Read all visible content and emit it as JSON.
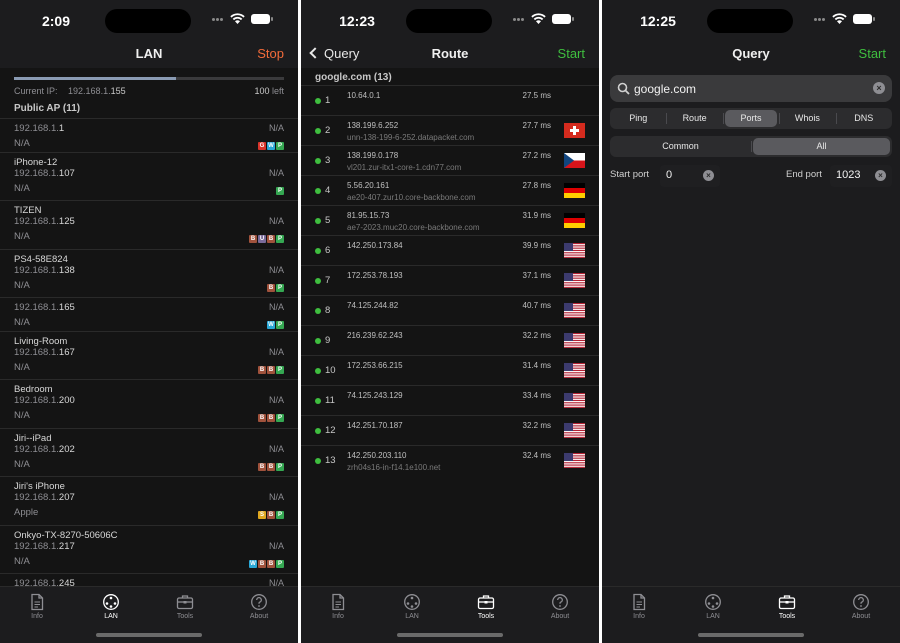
{
  "screens": {
    "lan": {
      "time": "2:09",
      "title": "LAN",
      "action": "Stop",
      "scan_progress": 0.6,
      "current_ip_label": "Current IP:",
      "current_ip_prefix": "192.168.1.",
      "current_ip_suffix": "155",
      "left_count": "100",
      "left_label": "left",
      "section": "Public AP (11)",
      "devices": [
        {
          "name": "",
          "ip_prefix": "192.168.1.",
          "ip_suffix": "1",
          "vendor": "N/A",
          "na": "N/A",
          "badges": [
            "G",
            "W",
            "P"
          ]
        },
        {
          "name": "iPhone-12",
          "ip_prefix": "192.168.1.",
          "ip_suffix": "107",
          "vendor": "N/A",
          "na": "N/A",
          "badges": [
            "P"
          ]
        },
        {
          "name": "TIZEN",
          "ip_prefix": "192.168.1.",
          "ip_suffix": "125",
          "vendor": "N/A",
          "na": "N/A",
          "badges": [
            "B",
            "U",
            "B",
            "P"
          ]
        },
        {
          "name": "PS4-58E824",
          "ip_prefix": "192.168.1.",
          "ip_suffix": "138",
          "vendor": "N/A",
          "na": "N/A",
          "badges": [
            "B",
            "P"
          ]
        },
        {
          "name": "",
          "ip_prefix": "192.168.1.",
          "ip_suffix": "165",
          "vendor": "N/A",
          "na": "N/A",
          "badges": [
            "W",
            "P"
          ]
        },
        {
          "name": "Living-Room",
          "ip_prefix": "192.168.1.",
          "ip_suffix": "167",
          "vendor": "N/A",
          "na": "N/A",
          "badges": [
            "B",
            "B",
            "P"
          ]
        },
        {
          "name": "Bedroom",
          "ip_prefix": "192.168.1.",
          "ip_suffix": "200",
          "vendor": "N/A",
          "na": "N/A",
          "badges": [
            "B",
            "B",
            "P"
          ]
        },
        {
          "name": "Jiri--iPad",
          "ip_prefix": "192.168.1.",
          "ip_suffix": "202",
          "vendor": "N/A",
          "na": "N/A",
          "badges": [
            "B",
            "B",
            "P"
          ]
        },
        {
          "name": "Jiri's iPhone",
          "ip_prefix": "192.168.1.",
          "ip_suffix": "207",
          "vendor": "Apple",
          "na": "N/A",
          "badges": [
            "S",
            "B",
            "P"
          ]
        },
        {
          "name": "Onkyo-TX-8270-50606C",
          "ip_prefix": "192.168.1.",
          "ip_suffix": "217",
          "vendor": "N/A",
          "na": "N/A",
          "badges": [
            "W",
            "B",
            "B",
            "P"
          ]
        },
        {
          "name": "",
          "ip_prefix": "192.168.1.",
          "ip_suffix": "245",
          "vendor": "",
          "na": "N/A",
          "badges": []
        }
      ],
      "badge_colors": {
        "G": "#d9342b",
        "W": "#2aa7d6",
        "P": "#35a852",
        "B": "#a0523c",
        "U": "#7a6b9a",
        "S": "#e0a820"
      }
    },
    "route": {
      "time": "12:23",
      "back": "Query",
      "title": "Route",
      "action": "Start",
      "header": "google.com (13)",
      "hops": [
        {
          "n": "1",
          "addr": "10.64.0.1",
          "host": "",
          "ms": "27.5 ms",
          "flag": ""
        },
        {
          "n": "2",
          "addr": "138.199.6.252",
          "host": "unn-138-199-6-252.datapacket.com",
          "ms": "27.7 ms",
          "flag": "ch"
        },
        {
          "n": "3",
          "addr": "138.199.0.178",
          "host": "vl201.zur-itx1-core-1.cdn77.com",
          "ms": "27.2 ms",
          "flag": "cz"
        },
        {
          "n": "4",
          "addr": "5.56.20.161",
          "host": "ae20-407.zur10.core-backbone.com",
          "ms": "27.8 ms",
          "flag": "de"
        },
        {
          "n": "5",
          "addr": "81.95.15.73",
          "host": "ae7-2023.muc20.core-backbone.com",
          "ms": "31.9 ms",
          "flag": "de"
        },
        {
          "n": "6",
          "addr": "142.250.173.84",
          "host": "",
          "ms": "39.9 ms",
          "flag": "us"
        },
        {
          "n": "7",
          "addr": "172.253.78.193",
          "host": "",
          "ms": "37.1 ms",
          "flag": "us"
        },
        {
          "n": "8",
          "addr": "74.125.244.82",
          "host": "",
          "ms": "40.7 ms",
          "flag": "us"
        },
        {
          "n": "9",
          "addr": "216.239.62.243",
          "host": "",
          "ms": "32.2 ms",
          "flag": "us"
        },
        {
          "n": "10",
          "addr": "172.253.66.215",
          "host": "",
          "ms": "31.4 ms",
          "flag": "us"
        },
        {
          "n": "11",
          "addr": "74.125.243.129",
          "host": "",
          "ms": "33.4 ms",
          "flag": "us"
        },
        {
          "n": "12",
          "addr": "142.251.70.187",
          "host": "",
          "ms": "32.2 ms",
          "flag": "us"
        },
        {
          "n": "13",
          "addr": "142.250.203.110",
          "host": "zrh04s16-in-f14.1e100.net",
          "ms": "32.4 ms",
          "flag": "us"
        }
      ]
    },
    "query": {
      "time": "12:25",
      "title": "Query",
      "action": "Start",
      "search_value": "google.com",
      "tools": [
        "Ping",
        "Route",
        "Ports",
        "Whois",
        "DNS"
      ],
      "selected_tool": "Ports",
      "modes": [
        "Common",
        "All"
      ],
      "selected_mode": "All",
      "start_port_label": "Start port",
      "start_port": "0",
      "end_port_label": "End port",
      "end_port": "1023"
    }
  },
  "tabs": [
    {
      "label": "Info",
      "icon": "doc-icon"
    },
    {
      "label": "LAN",
      "icon": "lan-icon"
    },
    {
      "label": "Tools",
      "icon": "toolbox-icon"
    },
    {
      "label": "About",
      "icon": "question-icon"
    }
  ],
  "colors": {
    "accent_orange": "#f26b3a",
    "accent_green": "#3fbf3f",
    "active_dot": "#3fbf3f"
  }
}
